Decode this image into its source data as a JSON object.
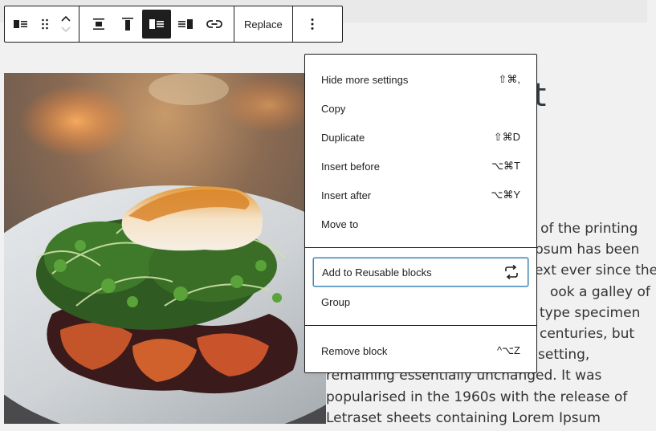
{
  "toolbar": {
    "block_type_icon": "image-block-icon",
    "drag_icon": "drag-handle-icon",
    "move_up_icon": "chevron-up-icon",
    "move_down_icon": "chevron-down-icon",
    "align_center_icon": "align-center-icon",
    "align_top_icon": "align-top-icon",
    "media_left_icon": "media-left-icon",
    "media_right_icon": "media-right-icon",
    "link_icon": "link-icon",
    "replace_label": "Replace",
    "more_icon": "more-vertical-icon"
  },
  "heading_fragment": "et",
  "paragraph_lines": [
    "xt of the printing",
    "psum has been",
    "ext ever since the",
    "ook a galley of",
    "type specimen",
    "centuries, but",
    "setting,",
    "remaining essentially unchanged. It was",
    "popularised in the 1960s with the release of",
    "Letraset sheets containing Lorem Ipsum"
  ],
  "menu": {
    "items": [
      {
        "label": "Hide more settings",
        "shortcut": "⇧⌘,"
      },
      {
        "label": "Copy",
        "shortcut": ""
      },
      {
        "label": "Duplicate",
        "shortcut": "⇧⌘D"
      },
      {
        "label": "Insert before",
        "shortcut": "⌥⌘T"
      },
      {
        "label": "Insert after",
        "shortcut": "⌥⌘Y"
      },
      {
        "label": "Move to",
        "shortcut": ""
      }
    ],
    "items2": [
      {
        "label": "Add to Reusable blocks",
        "icon": "reusable-block-icon"
      },
      {
        "label": "Group",
        "shortcut": ""
      }
    ],
    "items3": [
      {
        "label": "Remove block",
        "shortcut": "^⌥Z"
      }
    ]
  },
  "colors": {
    "accent": "#3c84b6",
    "toolbar_active": "#1e1e1e"
  }
}
